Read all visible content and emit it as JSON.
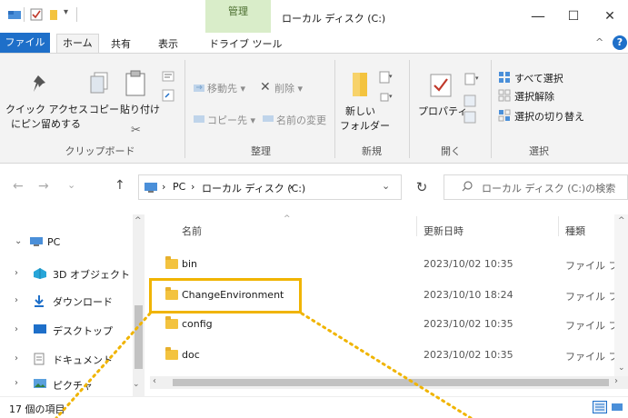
{
  "titlebar": {
    "context_tab": "管理",
    "title": "ローカル ディスク (C:)",
    "minimize": "—",
    "maximize": "☐",
    "close": "✕"
  },
  "tabs": {
    "file": "ファイル",
    "home": "ホーム",
    "share": "共有",
    "view": "表示",
    "drive_tools": "ドライブ ツール"
  },
  "ribbon": {
    "pin_line1": "クイック アクセス",
    "pin_line2": "にピン留めする",
    "copy": "コピー",
    "paste": "貼り付け",
    "clipboard_group": "クリップボード",
    "move_to": "移動先 ▾",
    "delete": "削除 ▾",
    "copy_to": "コピー先 ▾",
    "rename": "名前の変更",
    "organize_group": "整理",
    "new_folder_line1": "新しい",
    "new_folder_line2": "フォルダー",
    "new_group": "新規",
    "properties": "プロパティ",
    "open_group": "開く",
    "select_all": "すべて選択",
    "select_none": "選択解除",
    "invert_selection": "選択の切り替え",
    "select_group": "選択"
  },
  "nav": {
    "back": "←",
    "forward": "→",
    "recent": "⌄",
    "up": "↑",
    "path": [
      "PC",
      "ローカル ディスク (C:)"
    ],
    "refresh": "↻",
    "search_placeholder": "ローカル ディスク (C:)の検索"
  },
  "tree": [
    {
      "label": "PC",
      "expanded": true
    },
    {
      "label": "3D オブジェクト"
    },
    {
      "label": "ダウンロード"
    },
    {
      "label": "デスクトップ"
    },
    {
      "label": "ドキュメント"
    },
    {
      "label": "ピクチャ"
    }
  ],
  "columns": {
    "name": "名前",
    "date": "更新日時",
    "type": "種類"
  },
  "files": [
    {
      "name": "bin",
      "date": "2023/10/02 10:35",
      "type": "ファイル フォル"
    },
    {
      "name": "ChangeEnvironment",
      "date": "2023/10/10 18:24",
      "type": "ファイル フォル"
    },
    {
      "name": "config",
      "date": "2023/10/02 10:35",
      "type": "ファイル フォル"
    },
    {
      "name": "doc",
      "date": "2023/10/02 10:35",
      "type": "ファイル フォル"
    }
  ],
  "status": {
    "item_count": "17 個の項目"
  },
  "colors": {
    "file_tab": "#1e6fc9",
    "context_tab": "#d9edc9",
    "folder": "#f3c33f",
    "highlight": "#f0b400"
  }
}
